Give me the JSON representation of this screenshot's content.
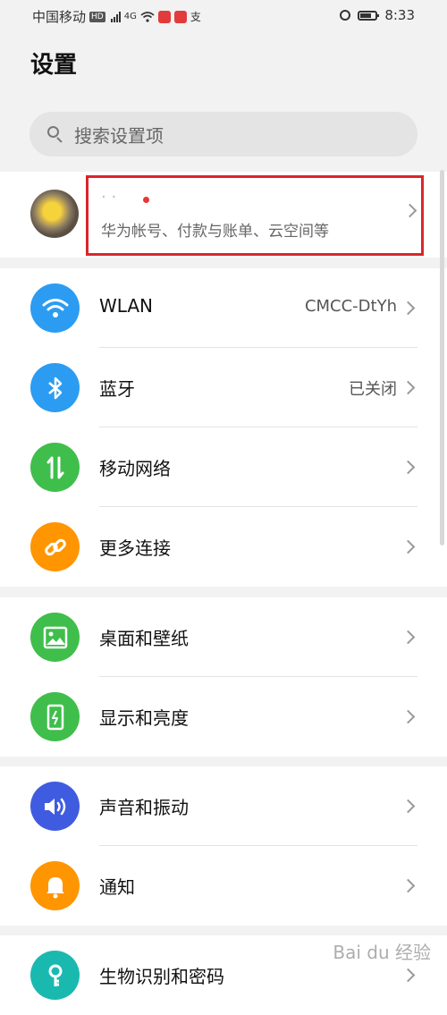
{
  "status_bar": {
    "carrier": "中国移动",
    "hd_badge": "HD",
    "network": "4G",
    "extra_glyph": "支",
    "time": "8:33"
  },
  "page_title": "设置",
  "search": {
    "placeholder": "搜索设置项"
  },
  "account": {
    "name_blurred": "· ·",
    "subtitle": "华为帐号、付款与账单、云空间等"
  },
  "groups": [
    {
      "items": [
        {
          "label": "WLAN",
          "value": "CMCC-DtYh",
          "icon": "wifi-icon",
          "color": "#2b9cf2"
        },
        {
          "label": "蓝牙",
          "value": "已关闭",
          "icon": "bluetooth-icon",
          "color": "#2b9cf2"
        },
        {
          "label": "移动网络",
          "value": "",
          "icon": "mobile-data-icon",
          "color": "#3fbe4b"
        },
        {
          "label": "更多连接",
          "value": "",
          "icon": "link-icon",
          "color": "#ff9500"
        }
      ]
    },
    {
      "items": [
        {
          "label": "桌面和壁纸",
          "value": "",
          "icon": "wallpaper-icon",
          "color": "#3fbe4b"
        },
        {
          "label": "显示和亮度",
          "value": "",
          "icon": "display-icon",
          "color": "#3fbe4b"
        }
      ]
    },
    {
      "items": [
        {
          "label": "声音和振动",
          "value": "",
          "icon": "sound-icon",
          "color": "#3f5ce0"
        },
        {
          "label": "通知",
          "value": "",
          "icon": "bell-icon",
          "color": "#ff9500"
        }
      ]
    },
    {
      "items": [
        {
          "label": "生物识别和密码",
          "value": "",
          "icon": "key-icon",
          "color": "#1ab9b0"
        }
      ]
    }
  ],
  "watermark": "Bai du 经验"
}
